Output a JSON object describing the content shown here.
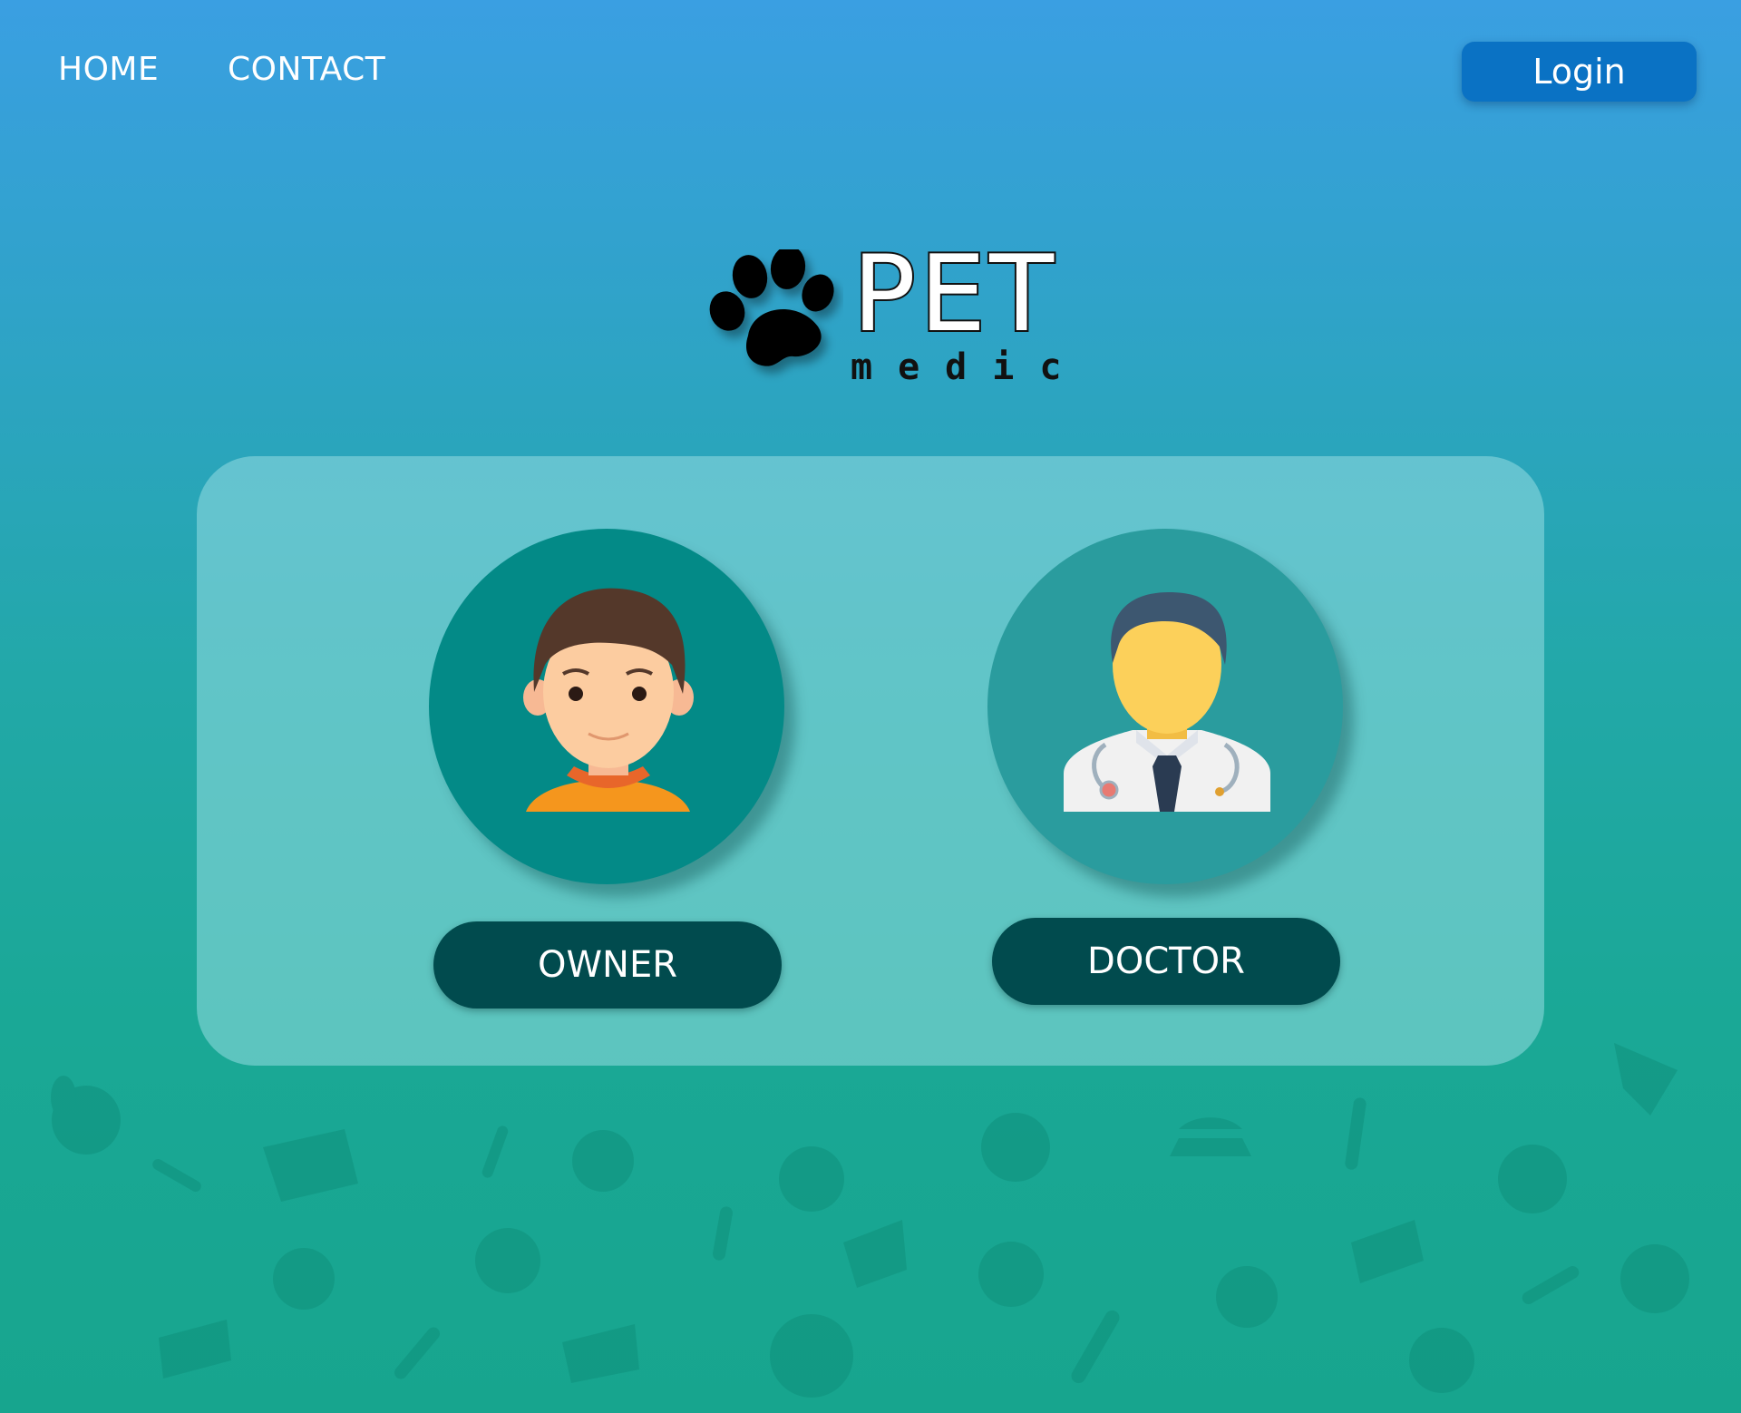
{
  "nav": {
    "home_label": "HOME",
    "contact_label": "CONTACT",
    "login_label": "Login"
  },
  "logo": {
    "title": "PET",
    "subtitle": "medic",
    "icon": "paw-icon"
  },
  "roles": {
    "owner_label": "OWNER",
    "doctor_label": "DOCTOR",
    "owner_icon": "person-avatar-icon",
    "doctor_icon": "doctor-avatar-icon"
  },
  "colors": {
    "login_button": "#0a72c4",
    "role_button": "#014b4e",
    "owner_circle": "#038a87",
    "doctor_circle": "#2a9c9e"
  }
}
